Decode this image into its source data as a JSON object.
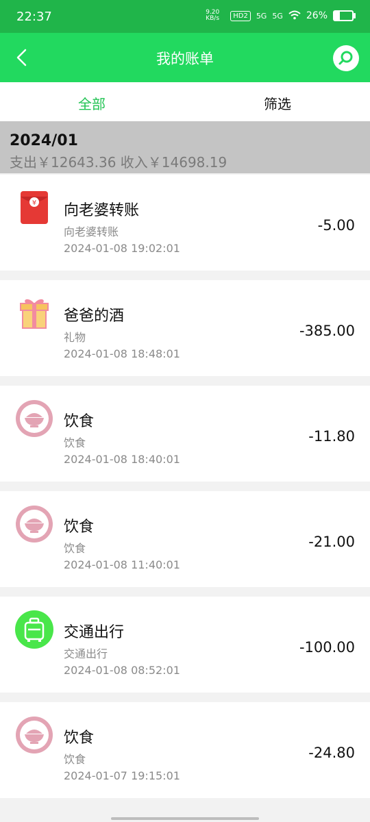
{
  "status": {
    "time": "22:37",
    "speed": "9.20 KB/s",
    "hd": "HD2",
    "net1": "5G",
    "net2": "5G",
    "battery": "26%"
  },
  "header": {
    "title": "我的账单",
    "back_icon": "chevron-left-icon",
    "search_icon": "search-icon"
  },
  "tabs": [
    {
      "label": "全部",
      "active": true
    },
    {
      "label": "筛选",
      "active": false
    }
  ],
  "month": {
    "label": "2024/01",
    "summary": "支出￥12643.36    收入￥14698.19"
  },
  "transactions": [
    {
      "title": "向老婆转账",
      "category": "向老婆转账",
      "datetime": "2024-01-08 19:02:01",
      "amount": "-5.00",
      "icon": "red-envelope-icon"
    },
    {
      "title": "爸爸的酒",
      "category": "礼物",
      "datetime": "2024-01-08 18:48:01",
      "amount": "-385.00",
      "icon": "gift-icon"
    },
    {
      "title": "饮食",
      "category": "饮食",
      "datetime": "2024-01-08 18:40:01",
      "amount": "-11.80",
      "icon": "food-bowl-icon"
    },
    {
      "title": "饮食",
      "category": "饮食",
      "datetime": "2024-01-08 11:40:01",
      "amount": "-21.00",
      "icon": "food-bowl-icon"
    },
    {
      "title": "交通出行",
      "category": "交通出行",
      "datetime": "2024-01-08 08:52:01",
      "amount": "-100.00",
      "icon": "luggage-icon"
    },
    {
      "title": "饮食",
      "category": "饮食",
      "datetime": "2024-01-07 19:15:01",
      "amount": "-24.80",
      "icon": "food-bowl-icon"
    }
  ],
  "colors": {
    "statusbar": "#20b54a",
    "topbar": "#22d95f",
    "accent": "#21c353",
    "food": "#e3a4b4",
    "transport": "#49e64a",
    "red_envelope": "#e53935",
    "gift": "#f9c86d"
  }
}
